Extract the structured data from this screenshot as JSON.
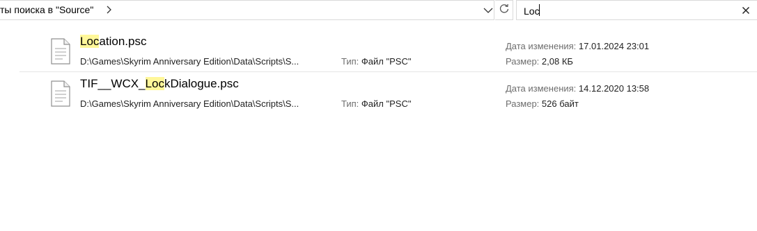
{
  "address_bar": {
    "text": "ты поиска в \"Source\""
  },
  "search": {
    "value": "Loc"
  },
  "results": [
    {
      "name_highlight": "Loc",
      "name_rest": "ation.psc",
      "path": "D:\\Games\\Skyrim Anniversary Edition\\Data\\Scripts\\S...",
      "type_label": "Тип:",
      "type_value": "Файл \"PSC\"",
      "modified_label": "Дата изменения:",
      "modified_value": "17.01.2024 23:01",
      "size_label": "Размер:",
      "size_value": "2,08 КБ"
    },
    {
      "name_prefix": "TIF__WCX_",
      "name_highlight": "Loc",
      "name_rest": "kDialogue.psc",
      "path": "D:\\Games\\Skyrim Anniversary Edition\\Data\\Scripts\\S...",
      "type_label": "Тип:",
      "type_value": "Файл \"PSC\"",
      "modified_label": "Дата изменения:",
      "modified_value": "14.12.2020 13:58",
      "size_label": "Размер:",
      "size_value": "526 байт"
    }
  ],
  "icons": {
    "breadcrumb_separator": "chevron-right-icon",
    "address_dropdown": "chevron-down-icon",
    "refresh": "refresh-icon",
    "clear_search": "close-icon",
    "file": "document-icon"
  },
  "colors": {
    "highlight": "#fff799",
    "label": "#6d6d6d",
    "border": "#d9d9d9"
  }
}
